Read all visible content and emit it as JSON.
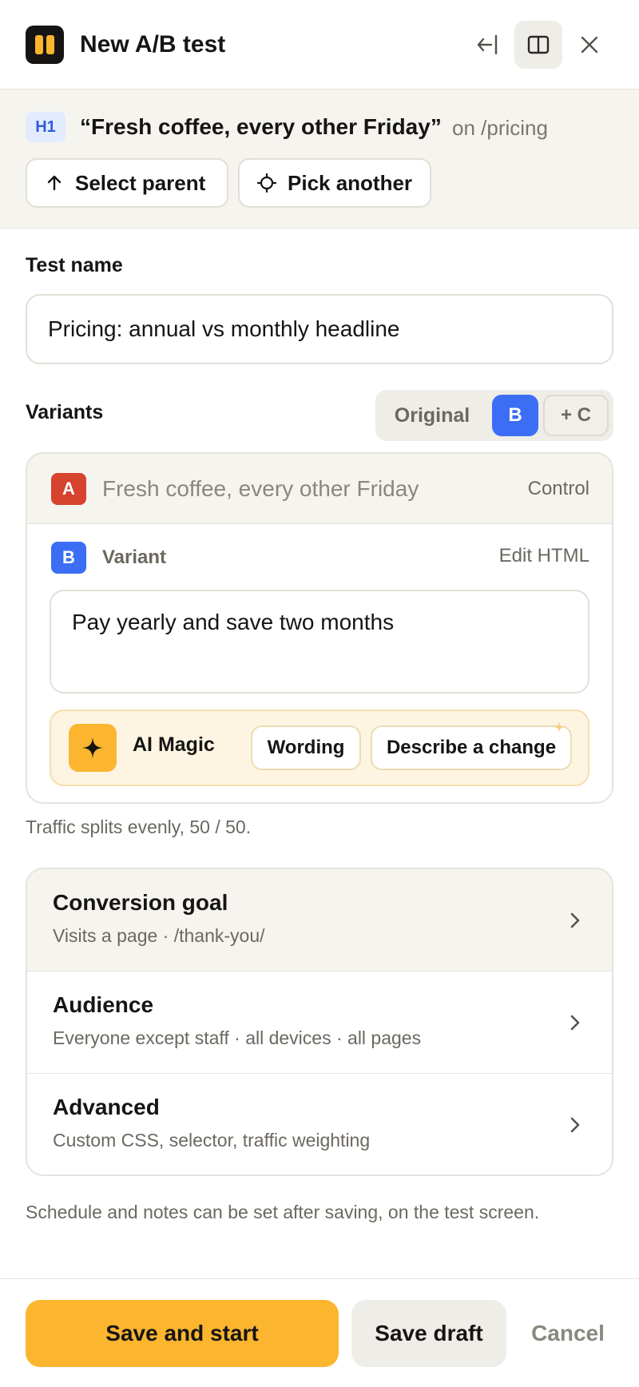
{
  "header": {
    "title": "New A/B test",
    "icons": {
      "logo": "pause-bars-logo",
      "collapse": "collapse-left-icon",
      "panel": "sidebar-panel-icon",
      "close": "close-icon"
    }
  },
  "selection": {
    "tag": "H1",
    "text": "“Fresh coffee, every other Friday”",
    "path": "on /pricing",
    "select_parent": "Select parent",
    "pick_another": "Pick another"
  },
  "test_name": {
    "label": "Test name",
    "value": "Pricing: annual vs monthly headline"
  },
  "variants": {
    "label": "Variants",
    "segments": {
      "original": "Original",
      "b": "B",
      "add_c": "+ C"
    },
    "a": {
      "badge": "A",
      "text": "Fresh coffee, every other Friday",
      "role": "Control"
    },
    "b": {
      "badge": "B",
      "label": "Variant",
      "edit": "Edit HTML",
      "value": "Pay yearly and save two months"
    },
    "ai": {
      "label": "AI Magic",
      "chip_wording": "Wording",
      "chip_describe": "Describe a change"
    },
    "traffic_note": "Traffic splits evenly, 50 / 50."
  },
  "settings": [
    {
      "title": "Conversion goal",
      "subtitle": "Visits a page · /thank-you/"
    },
    {
      "title": "Audience",
      "subtitle": "Everyone except staff · all devices · all pages"
    },
    {
      "title": "Advanced",
      "subtitle": "Custom CSS, selector, traffic weighting"
    }
  ],
  "schedule_note": "Schedule and notes can be set after saving, on the test screen.",
  "footer": {
    "primary": "Save and start",
    "draft": "Save draft",
    "cancel": "Cancel"
  },
  "colors": {
    "accent": "#fbb52f",
    "variant_a": "#d6432e",
    "variant_b": "#3b6ef5"
  }
}
